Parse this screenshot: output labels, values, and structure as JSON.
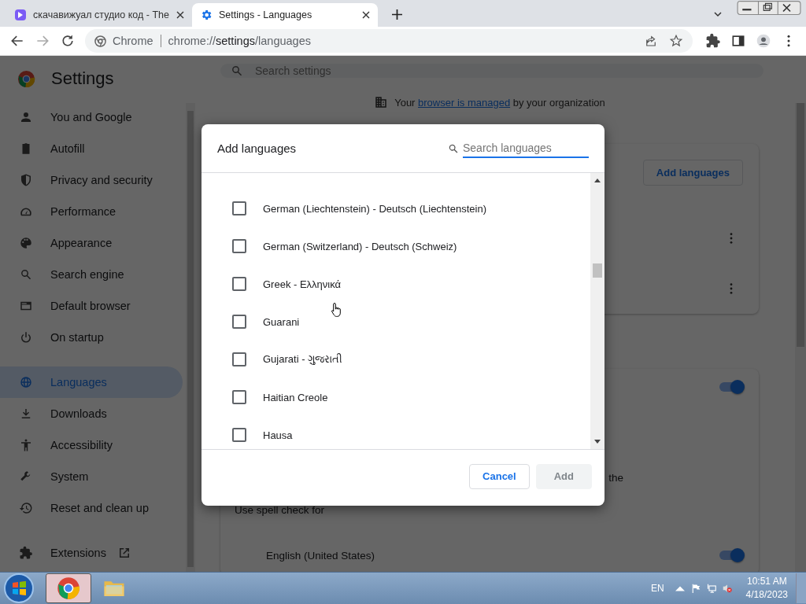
{
  "browser": {
    "tabs": [
      {
        "title": "скачавижуал студио код - The",
        "selected": false
      },
      {
        "title": "Settings - Languages",
        "selected": true
      }
    ],
    "address": {
      "site": "Chrome",
      "scheme": "chrome://",
      "host": "settings",
      "path": "/languages"
    }
  },
  "settings": {
    "title": "Settings",
    "search_placeholder": "Search settings",
    "nav": [
      {
        "label": "You and Google",
        "selected": false
      },
      {
        "label": "Autofill",
        "selected": false
      },
      {
        "label": "Privacy and security",
        "selected": false
      },
      {
        "label": "Performance",
        "selected": false
      },
      {
        "label": "Appearance",
        "selected": false
      },
      {
        "label": "Search engine",
        "selected": false
      },
      {
        "label": "Default browser",
        "selected": false
      },
      {
        "label": "On startup",
        "selected": false
      },
      {
        "label": "Languages",
        "selected": true
      },
      {
        "label": "Downloads",
        "selected": false
      },
      {
        "label": "Accessibility",
        "selected": false
      },
      {
        "label": "System",
        "selected": false
      },
      {
        "label": "Reset and clean up",
        "selected": false
      },
      {
        "label": "Extensions",
        "selected": false
      }
    ],
    "managed": {
      "before": "Your ",
      "link": "browser is managed",
      "after": " by your organization"
    },
    "add_button": "Add languages",
    "cut_text": "the",
    "spell_check_label": "Use spell check for",
    "spell_language": "English (United States)",
    "toggles": [
      {
        "on": true
      },
      {
        "on": true
      }
    ]
  },
  "dialog": {
    "title": "Add languages",
    "search_placeholder": "Search languages",
    "languages": [
      {
        "label": "German (Liechtenstein) - Deutsch (Liechtenstein)",
        "checked": false
      },
      {
        "label": "German (Switzerland) - Deutsch (Schweiz)",
        "checked": false
      },
      {
        "label": "Greek - Ελληνικά",
        "checked": false
      },
      {
        "label": "Guarani",
        "checked": false
      },
      {
        "label": "Gujarati - ગુજરાતી",
        "checked": false
      },
      {
        "label": "Haitian Creole",
        "checked": false
      },
      {
        "label": "Hausa",
        "checked": false
      }
    ],
    "buttons": [
      {
        "label": "Cancel",
        "disabled": false
      },
      {
        "label": "Add",
        "disabled": true
      }
    ]
  },
  "taskbar": {
    "language": "EN",
    "time": "10:51 AM",
    "date": "4/18/2023"
  }
}
